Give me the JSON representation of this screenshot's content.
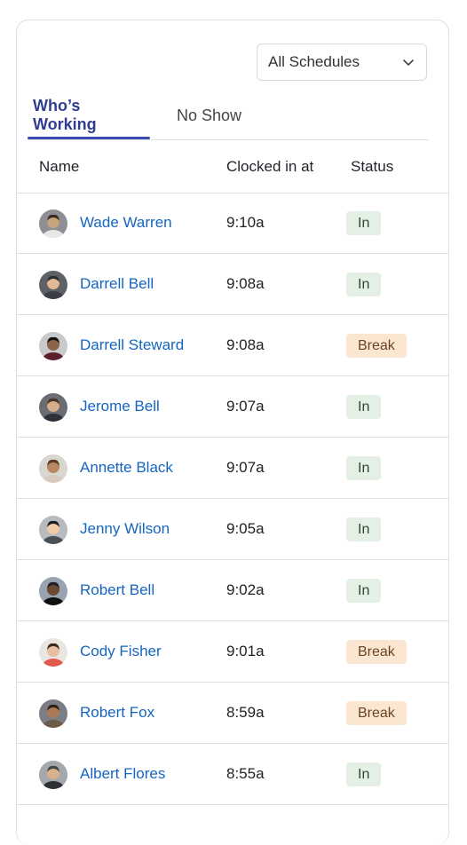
{
  "filter": {
    "selected": "All Schedules"
  },
  "tabs": [
    {
      "label": "Who’s Working",
      "active": true
    },
    {
      "label": "No Show",
      "active": false
    }
  ],
  "columns": {
    "name": "Name",
    "clocked": "Clocked in at",
    "status": "Status"
  },
  "rows": [
    {
      "name": "Wade Warren",
      "time": "9:10a",
      "status": "In"
    },
    {
      "name": "Darrell Bell",
      "time": "9:08a",
      "status": "In"
    },
    {
      "name": "Darrell Steward",
      "time": "9:08a",
      "status": "Break"
    },
    {
      "name": "Jerome Bell",
      "time": "9:07a",
      "status": "In"
    },
    {
      "name": "Annette Black",
      "time": "9:07a",
      "status": "In"
    },
    {
      "name": "Jenny Wilson",
      "time": "9:05a",
      "status": "In"
    },
    {
      "name": "Robert Bell",
      "time": "9:02a",
      "status": "In"
    },
    {
      "name": "Cody Fisher",
      "time": "9:01a",
      "status": "Break"
    },
    {
      "name": "Robert Fox",
      "time": "8:59a",
      "status": "Break"
    },
    {
      "name": "Albert Flores",
      "time": "8:55a",
      "status": "In"
    }
  ],
  "colors": {
    "accent": "#3a4bb0",
    "link": "#1565c0",
    "status_in_bg": "#e4efe5",
    "status_break_bg": "#fbe6d2"
  }
}
